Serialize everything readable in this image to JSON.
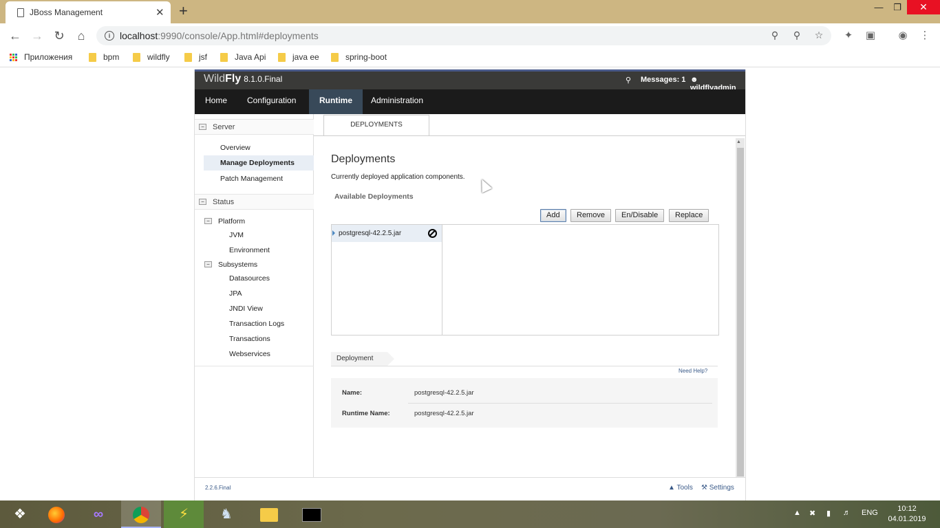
{
  "browser": {
    "tab_title": "JBoss Management",
    "tab_close": "✕",
    "new_tab": "+",
    "url_host": "localhost",
    "url_rest": ":9990/console/App.html#deployments",
    "bookmarks": [
      {
        "label": "Приложения",
        "icon": "apps-grid-icon"
      },
      {
        "label": "bpm",
        "icon": "folder-icon"
      },
      {
        "label": "wildfly",
        "icon": "folder-icon"
      },
      {
        "label": "jsf",
        "icon": "folder-icon"
      },
      {
        "label": "Java Api",
        "icon": "folder-icon"
      },
      {
        "label": "java ee",
        "icon": "folder-icon"
      },
      {
        "label": "spring-boot",
        "icon": "folder-icon"
      }
    ]
  },
  "app": {
    "brand_prefix": "Wild",
    "brand_bold": "Fly",
    "brand_version": "8.1.0.Final",
    "messages": "Messages: 1",
    "user": "wildflyadmin",
    "nav": [
      "Home",
      "Configuration",
      "Runtime",
      "Administration"
    ],
    "active_nav": "Runtime",
    "sidebar": {
      "server_section": "Server",
      "server_items": [
        "Overview",
        "Manage Deployments",
        "Patch Management"
      ],
      "selected_item": "Manage Deployments",
      "status_section": "Status",
      "platform_group": "Platform",
      "platform_items": [
        "JVM",
        "Environment"
      ],
      "subsystems_group": "Subsystems",
      "subsystem_items": [
        "Datasources",
        "JPA",
        "JNDI View",
        "Transaction Logs",
        "Transactions",
        "Webservices"
      ]
    },
    "content": {
      "tab": "DEPLOYMENTS",
      "title": "Deployments",
      "description": "Currently deployed application components.",
      "available_label": "Available Deployments",
      "buttons": [
        "Add",
        "Remove",
        "En/Disable",
        "Replace"
      ],
      "deployments": [
        "postgresql-42.2.5.jar"
      ],
      "detail_tab": "Deployment",
      "need_help": "Need Help?",
      "name_label": "Name:",
      "name_value": "postgresql-42.2.5.jar",
      "runtime_label": "Runtime Name:",
      "runtime_value": "postgresql-42.2.5.jar"
    },
    "footer": {
      "version": "2.2.6.Final",
      "tools": "Tools",
      "settings": "Settings"
    }
  },
  "taskbar": {
    "lang": "ENG",
    "time": "10:12",
    "date": "04.01.2019"
  }
}
